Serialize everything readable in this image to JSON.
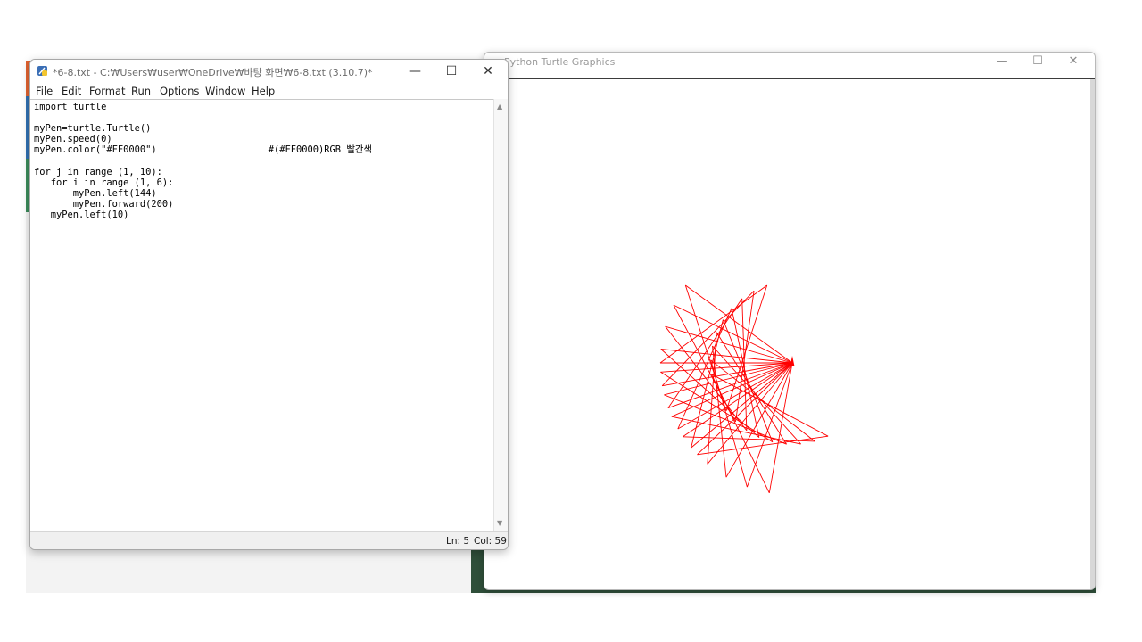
{
  "idle_window": {
    "title": "*6-8.txt - C:₩Users₩user₩OneDrive₩바탕 화면₩6-8.txt (3.10.7)*",
    "controls": {
      "minimize": "—",
      "maximize": "☐",
      "close": "✕"
    },
    "menu": [
      "File",
      "Edit",
      "Format",
      "Run",
      "Options",
      "Window",
      "Help"
    ],
    "code_lines": [
      "import turtle",
      "",
      "myPen=turtle.Turtle()",
      "myPen.speed(0)",
      "myPen.color(\"#FF0000\")                    #(#FF0000)RGB 빨간색",
      "",
      "for j in range (1, 10):",
      "   for i in range (1, 6):",
      "       myPen.left(144)",
      "       myPen.forward(200)",
      "   myPen.left(10)"
    ],
    "status": {
      "line": "Ln: 5",
      "col": "Col: 59"
    }
  },
  "turtle_window": {
    "title": "Python Turtle Graphics",
    "controls": {
      "minimize": "—",
      "maximize": "☐",
      "close": "✕"
    }
  },
  "drawing": {
    "pen_color": "#FF0000",
    "repeats": 9,
    "points_per_star": 5,
    "turn_per_point_deg": 144,
    "forward_length": 200,
    "turn_between_stars_deg": 10
  },
  "colors": {
    "desktop_dark": "#2f4f3a",
    "strip_colors": [
      "#e0622f",
      "#2f6fb0",
      "#3a8a5a"
    ]
  }
}
